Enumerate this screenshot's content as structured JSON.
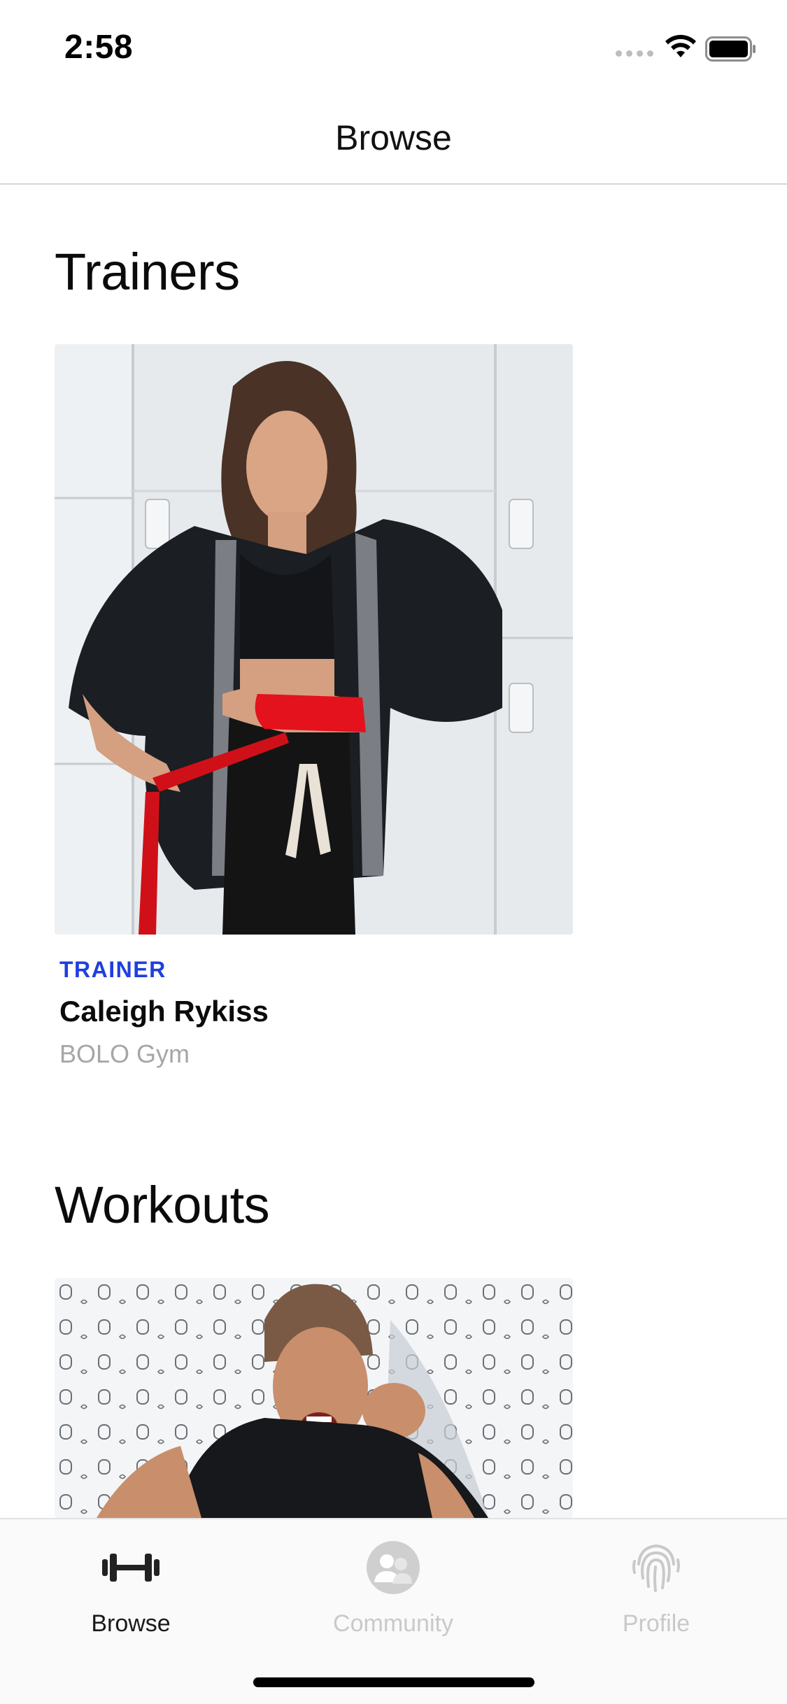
{
  "status_bar": {
    "time": "2:58"
  },
  "nav": {
    "title": "Browse"
  },
  "trainers": {
    "section_title": "Trainers",
    "card": {
      "tag": "TRAINER",
      "name": "Caleigh Rykiss",
      "gym": "BOLO Gym"
    }
  },
  "workouts": {
    "section_title": "Workouts"
  },
  "tab_bar": {
    "tabs": [
      {
        "label": "Browse",
        "icon": "dumbbell-icon",
        "active": true
      },
      {
        "label": "Community",
        "icon": "community-icon",
        "active": false
      },
      {
        "label": "Profile",
        "icon": "fingerprint-icon",
        "active": false
      }
    ]
  },
  "colors": {
    "accent": "#1f3fe0",
    "secondary_text": "#a6a6a6",
    "inactive_tab": "#c9c9c9"
  }
}
